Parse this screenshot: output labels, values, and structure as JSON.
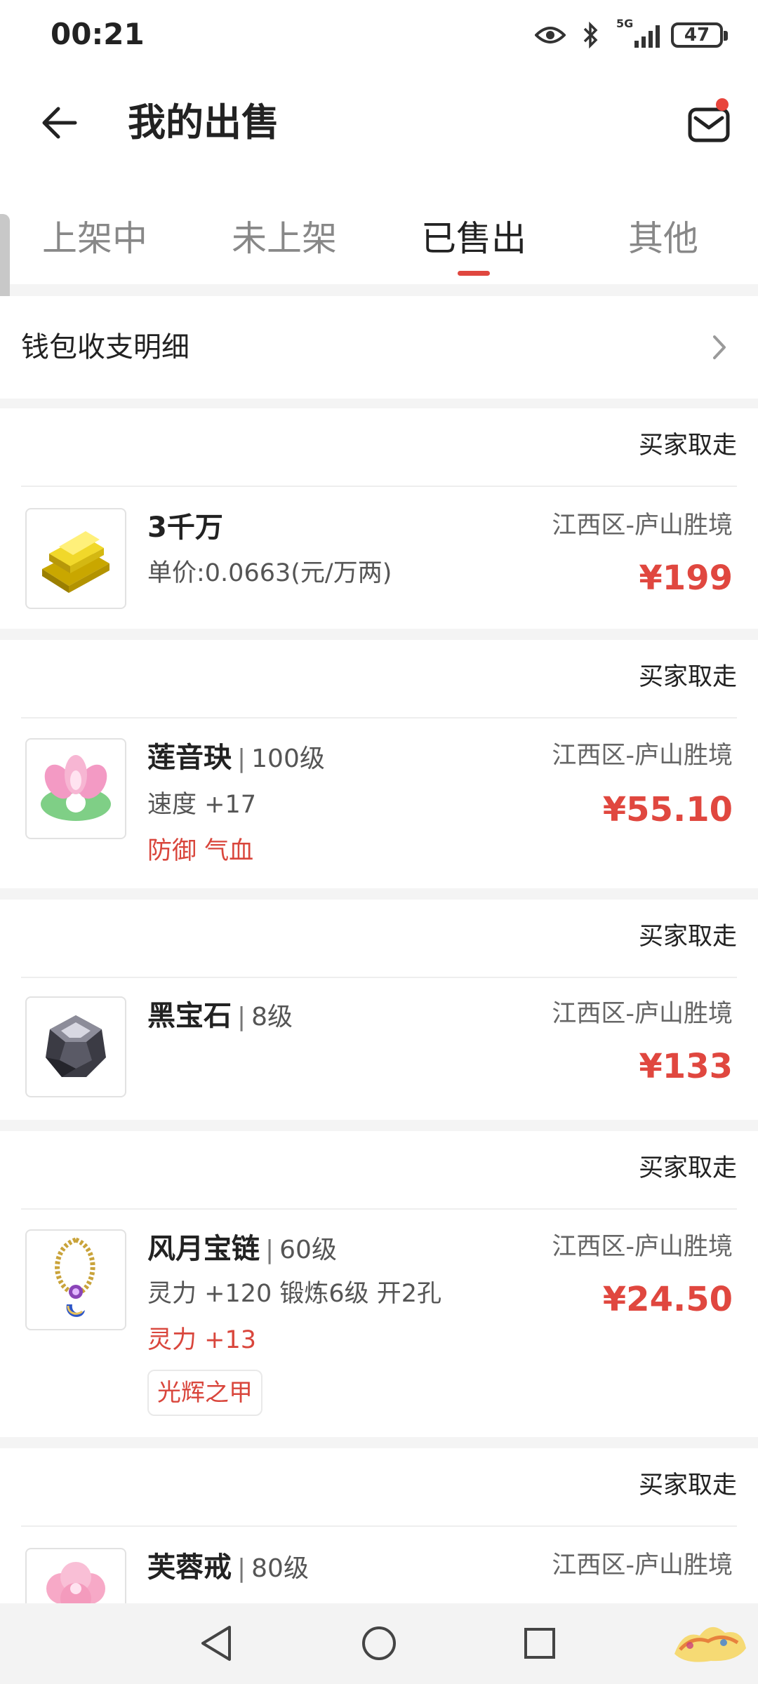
{
  "status_bar": {
    "time": "00:21",
    "network": "5G",
    "battery": "47"
  },
  "header": {
    "title": "我的出售"
  },
  "tabs": [
    {
      "label": "上架中",
      "active": false
    },
    {
      "label": "未上架",
      "active": false
    },
    {
      "label": "已售出",
      "active": true
    },
    {
      "label": "其他",
      "active": false
    }
  ],
  "wallet": {
    "label": "钱包收支明细"
  },
  "items": [
    {
      "status": "买家取走",
      "title": "3千万",
      "level": "",
      "line1": "单价:0.0663(元/万两)",
      "red_line": "",
      "tag": "",
      "server": "江西区-庐山胜境",
      "price": "¥199",
      "icon": "gold-bars-icon"
    },
    {
      "status": "买家取走",
      "title": "莲音玦",
      "level": "100级",
      "line1": "速度 +17",
      "red_line": "防御 气血",
      "tag": "",
      "server": "江西区-庐山胜境",
      "price": "¥55.10",
      "icon": "lotus-jade-icon"
    },
    {
      "status": "买家取走",
      "title": "黑宝石",
      "level": "8级",
      "line1": "",
      "red_line": "",
      "tag": "",
      "server": "江西区-庐山胜境",
      "price": "¥133",
      "icon": "black-gem-icon"
    },
    {
      "status": "买家取走",
      "title": "风月宝链",
      "level": "60级",
      "line1": "灵力 +120 锻炼6级 开2孔",
      "red_line": "灵力 +13",
      "tag": "光辉之甲",
      "server": "江西区-庐山胜境",
      "price": "¥24.50",
      "icon": "necklace-icon"
    },
    {
      "status": "买家取走",
      "title": "芙蓉戒",
      "level": "80级",
      "line1": "",
      "red_line": "",
      "tag": "",
      "server": "江西区-庐山胜境",
      "price": "",
      "icon": "hibiscus-ring-icon"
    }
  ],
  "colors": {
    "accent": "#e0473f",
    "background": "#f4f4f4",
    "card": "#ffffff"
  }
}
